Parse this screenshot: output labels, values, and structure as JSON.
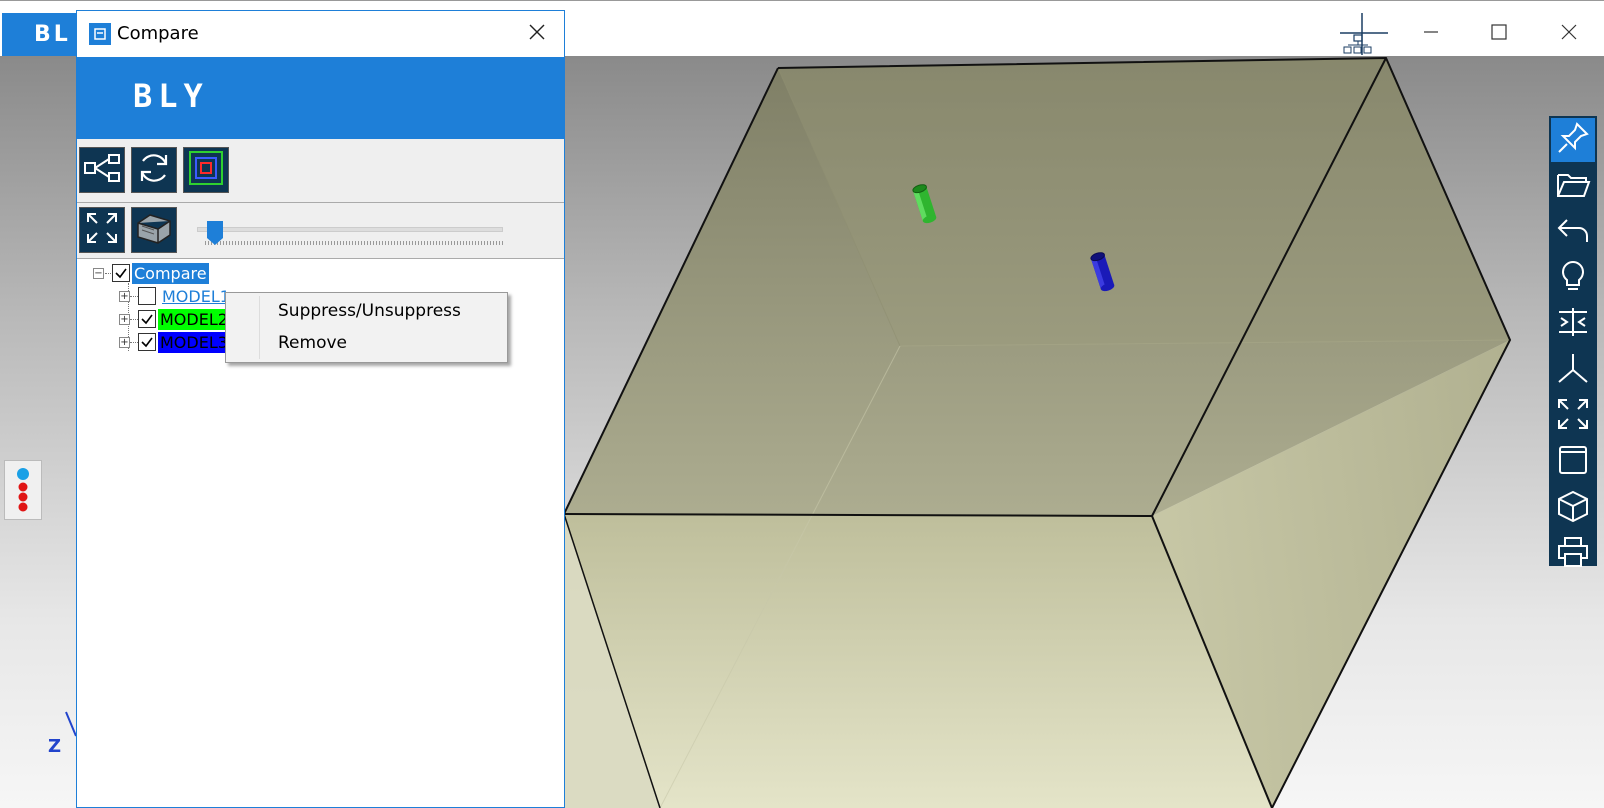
{
  "app": {
    "tab_label": "BL",
    "brand_color": "#1e7fd8",
    "toolbar_color": "#0e3552",
    "window_controls": [
      "minimize-icon",
      "maximize-icon",
      "close-icon"
    ]
  },
  "viewport": {
    "axis_label": "Z",
    "box_color": "#dcdcae",
    "model2_color": "#2fb52f",
    "model3_color": "#1a1ab8"
  },
  "right_toolbar": {
    "icons": [
      "pin-icon",
      "folder-open-icon",
      "undo-icon",
      "lightbulb-icon",
      "align-icon",
      "axes-icon",
      "fit-view-icon",
      "frame-icon",
      "view-cube-icon",
      "print-icon"
    ]
  },
  "dialog": {
    "title": "Compare",
    "banner_logo": "BLY",
    "toolbar1_icons": [
      "hierarchy-icon",
      "refresh-icon",
      "nested-squares-icon"
    ],
    "toolbar2_icons": [
      "expand-icon",
      "section-box-icon"
    ],
    "slider": {
      "value": 0.05
    },
    "tree": {
      "root": {
        "label": "Compare",
        "checked": true,
        "expanded": true
      },
      "children": [
        {
          "label": "MODEL1",
          "checked": false,
          "color": "#ffffff",
          "text_color": "#1e7fd8"
        },
        {
          "label": "MODEL2",
          "checked": true,
          "color": "#00ff00",
          "text_color": "#000000"
        },
        {
          "label": "MODEL3",
          "checked": true,
          "color": "#0000ff",
          "text_color": "#000000"
        }
      ]
    }
  },
  "context_menu": {
    "items": [
      "Suppress/Unsuppress",
      "Remove"
    ]
  }
}
